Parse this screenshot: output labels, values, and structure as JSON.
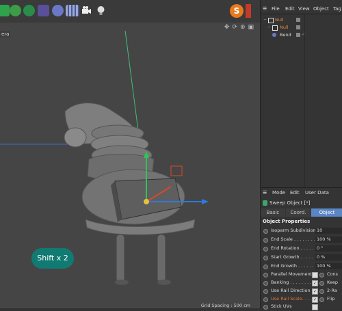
{
  "toolbar": {
    "icons": [
      "cube-icon",
      "spline-pen-icon",
      "generator-icon",
      "deformer-icon",
      "nurbs-icon",
      "scene-floor-icon",
      "camera-icon",
      "light-icon"
    ],
    "brand_letter": "S"
  },
  "viewport": {
    "camera_label": "era",
    "grid_spacing": "Grid Spacing : 500 cm",
    "shift_badge": "Shift x 2"
  },
  "object_manager": {
    "menu": [
      "File",
      "Edit",
      "View",
      "Object",
      "Tag"
    ],
    "objects": [
      {
        "name": "Null",
        "color": "#e08a3a"
      },
      {
        "name": "Null",
        "color": "#e08a3a"
      },
      {
        "name": "Bend",
        "color": "#dddddd"
      }
    ]
  },
  "attribute_manager": {
    "menu": [
      "Mode",
      "Edit",
      "User Data"
    ],
    "object_title": "Sweep Object [*]",
    "tabs": [
      "Basic",
      "Coord.",
      "Object"
    ],
    "active_tab": "Object",
    "section_title": "Object Properties",
    "properties": [
      {
        "label": "Isoparm Subdivision",
        "value": "10"
      },
      {
        "label": "End Scale . . . . . . . .",
        "value": "100 %"
      },
      {
        "label": "End Rotation . . . . .",
        "value": "0 °"
      },
      {
        "label": "Start Growth . . . . .",
        "value": "0 %"
      },
      {
        "label": "End Growth . . . . . .",
        "value": "100 %"
      }
    ],
    "checkbox_rows": [
      {
        "label": "Parallel Movement",
        "checked": false,
        "right_label": "Cons"
      },
      {
        "label": "Banking . . . . . . . . .",
        "checked": true,
        "right_label": "Keep"
      },
      {
        "label": "Use Rail Direction",
        "checked": true,
        "right_label": "2-Ra"
      },
      {
        "label": "Use Rail Scale. . . .",
        "checked": true,
        "right_label": "Flip",
        "highlight": true
      },
      {
        "label": "Stick UVs",
        "checked": false,
        "right_label": ""
      }
    ]
  }
}
